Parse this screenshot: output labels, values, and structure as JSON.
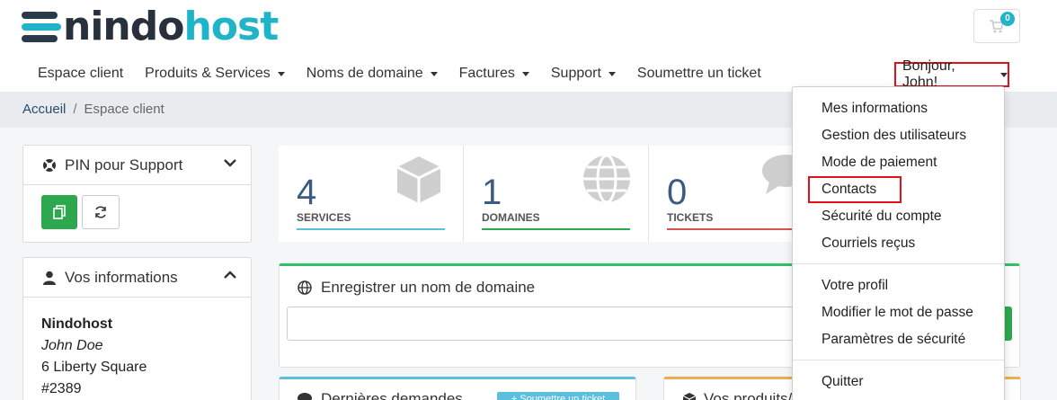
{
  "brand": {
    "logo_dark": "nindo",
    "logo_light": "host"
  },
  "cart": {
    "count": "0"
  },
  "nav": {
    "items": [
      {
        "label": "Espace client"
      },
      {
        "label": "Produits & Services"
      },
      {
        "label": "Noms de domaine"
      },
      {
        "label": "Factures"
      },
      {
        "label": "Support"
      },
      {
        "label": "Soumettre un ticket"
      }
    ],
    "user_greeting": "Bonjour, John!"
  },
  "breadcrumb": {
    "home": "Accueil",
    "sep": "/",
    "current": "Espace client"
  },
  "sidebar": {
    "pin_title": "PIN pour Support",
    "info_title": "Vos informations",
    "info": {
      "company": "Nindohost",
      "name": "John Doe",
      "address1": "6 Liberty Square",
      "address2": "#2389"
    }
  },
  "stats": [
    {
      "value": "4",
      "label": "SERVICES"
    },
    {
      "value": "1",
      "label": "DOMAINES"
    },
    {
      "value": "0",
      "label": "TICKETS"
    }
  ],
  "domain_card": {
    "title": "Enregistrer un nom de domaine"
  },
  "bottom_cards": {
    "tickets_title": "Dernières demandes",
    "submit_label": "+ Soumettre un ticket",
    "products_title": "Vos produits/"
  },
  "dropdown": {
    "items": [
      {
        "label": "Mes informations"
      },
      {
        "label": "Gestion des utilisateurs"
      },
      {
        "label": "Mode de paiement"
      },
      {
        "label": "Contacts"
      },
      {
        "label": "Sécurité du compte"
      },
      {
        "label": "Courriels reçus"
      },
      {
        "label": "Votre profil"
      },
      {
        "label": "Modifier le mot de passe"
      },
      {
        "label": "Paramètres de sécurité"
      },
      {
        "label": "Quitter"
      }
    ]
  },
  "colors": {
    "brand_teal": "#1fb4c7",
    "brand_dark": "#27303b",
    "success": "#2ea84e",
    "highlight_red": "#e3101c"
  }
}
